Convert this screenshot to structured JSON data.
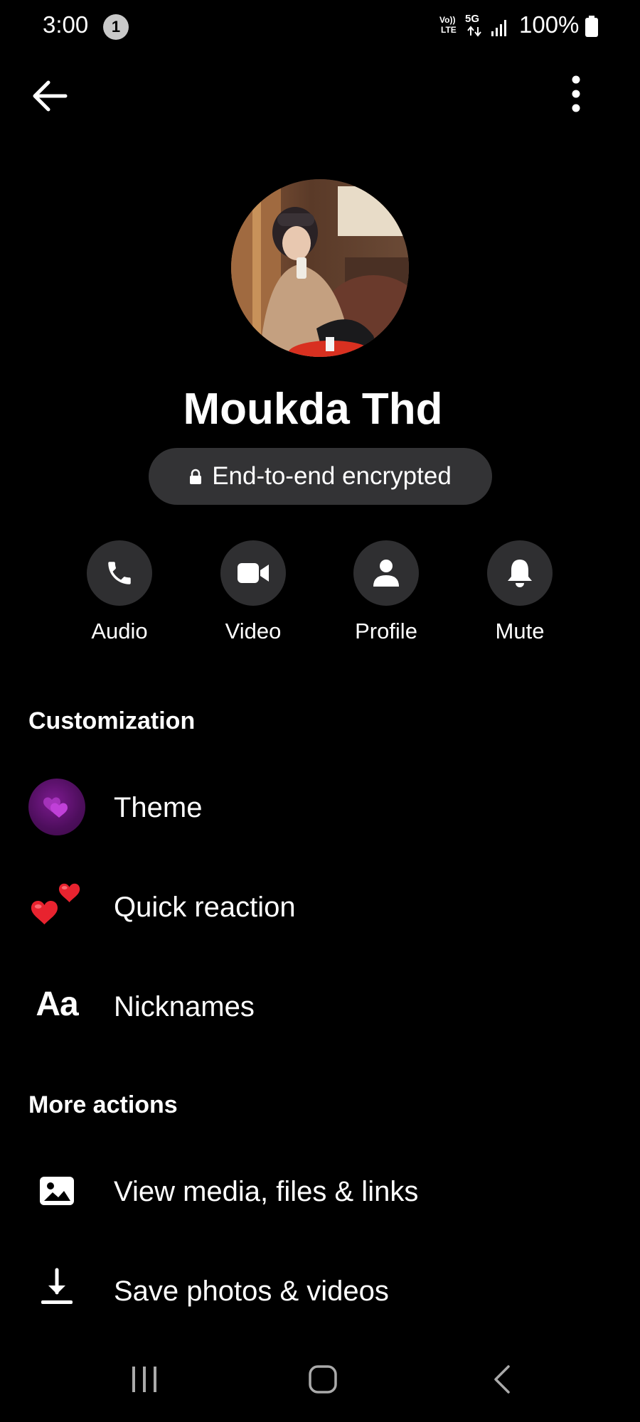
{
  "status_bar": {
    "time": "3:00",
    "notification_count": "1",
    "volte_line1": "Vo))",
    "volte_line2": "LTE",
    "network": "5G",
    "battery": "100%"
  },
  "header": {
    "back_icon": "arrow-left-icon",
    "more_icon": "more-vertical-icon"
  },
  "profile": {
    "name": "Moukda Thd",
    "encryption_label": "End-to-end encrypted"
  },
  "actions": [
    {
      "label": "Audio",
      "icon": "phone-icon"
    },
    {
      "label": "Video",
      "icon": "video-camera-icon"
    },
    {
      "label": "Profile",
      "icon": "person-icon"
    },
    {
      "label": "Mute",
      "icon": "bell-icon"
    }
  ],
  "customization": {
    "title": "Customization",
    "items": [
      {
        "label": "Theme",
        "icon": "theme-hearts-icon"
      },
      {
        "label": "Quick reaction",
        "icon": "two-hearts-icon"
      },
      {
        "label": "Nicknames",
        "icon": "text-aa-icon",
        "icon_text": "Aa"
      }
    ]
  },
  "more_actions": {
    "title": "More actions",
    "items": [
      {
        "label": "View media, files & links",
        "icon": "image-icon"
      },
      {
        "label": "Save photos & videos",
        "icon": "download-icon"
      }
    ]
  },
  "nav_bar": {
    "recents_icon": "recents-icon",
    "home_icon": "home-icon",
    "back_icon": "nav-back-icon"
  },
  "colors": {
    "background": "#000000",
    "pill": "#333335",
    "action_circle": "#2f2f31",
    "theme_purple": "#7c1a8f",
    "heart_red": "#e8232f"
  }
}
